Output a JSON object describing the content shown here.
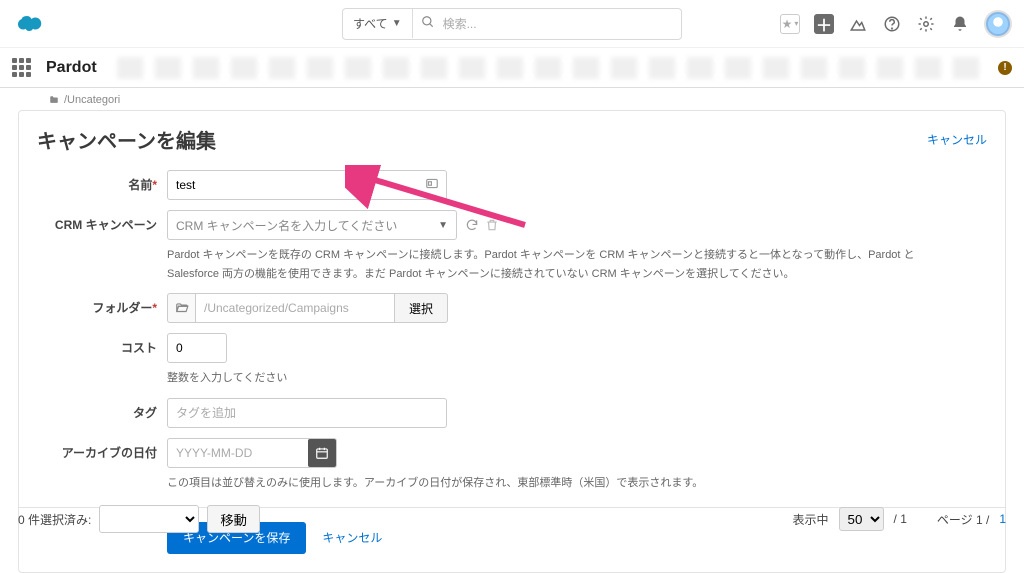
{
  "header": {
    "search_scope": "すべて",
    "search_placeholder": "検索..."
  },
  "nav": {
    "app_name": "Pardot"
  },
  "breadcrumb": {
    "path": "/Uncategori"
  },
  "page": {
    "title": "キャンペーンを編集",
    "cancel": "キャンセル"
  },
  "form": {
    "name": {
      "label": "名前",
      "value": "test"
    },
    "crm": {
      "label": "CRM キャンペーン",
      "placeholder": "CRM キャンペーン名を入力してください",
      "help": "Pardot キャンペーンを既存の CRM キャンペーンに接続します。Pardot キャンペーンを CRM キャンペーンと接続すると一体となって動作し、Pardot と Salesforce 両方の機能を使用できます。まだ Pardot キャンペーンに接続されていない CRM キャンペーンを選択してください。"
    },
    "folder": {
      "label": "フォルダー",
      "value": "/Uncategorized/Campaigns",
      "select_btn": "選択"
    },
    "cost": {
      "label": "コスト",
      "value": "0",
      "help": "整数を入力してください"
    },
    "tag": {
      "label": "タグ",
      "placeholder": "タグを追加"
    },
    "archive": {
      "label": "アーカイブの日付",
      "placeholder": "YYYY-MM-DD",
      "help": "この項目は並び替えのみに使用します。アーカイブの日付が保存され、東部標準時（米国）で表示されます。"
    }
  },
  "actions": {
    "save": "キャンペーンを保存",
    "cancel": "キャンセル"
  },
  "footer": {
    "selected_label": "0 件選択済み:",
    "move": "移動",
    "showing": "表示中",
    "page_size": "50",
    "per_divider": "/ 1",
    "page_label": "ページ 1 /",
    "page_total": "1"
  }
}
